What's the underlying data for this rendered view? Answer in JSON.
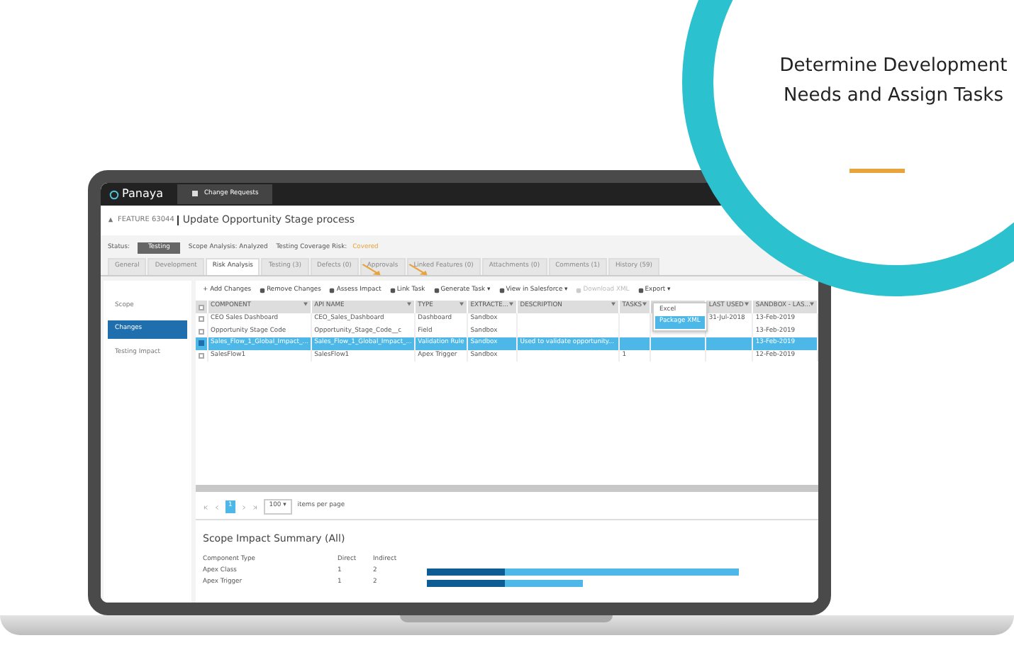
{
  "app": {
    "logo": "Panaya",
    "nav_tab": "Change Requests"
  },
  "feature": {
    "id": "FEATURE 63044",
    "title": "Update Opportunity Stage process"
  },
  "status": {
    "label": "Status:",
    "value": "Testing",
    "scope": "Scope Analysis: Analyzed",
    "risk_label": "Testing Coverage Risk:",
    "risk_value": "Covered"
  },
  "tabs": [
    {
      "label": "General",
      "selected": false
    },
    {
      "label": "Development",
      "selected": false
    },
    {
      "label": "Risk Analysis",
      "selected": true
    },
    {
      "label": "Testing (3)",
      "selected": false
    },
    {
      "label": "Defects (0)",
      "selected": false
    },
    {
      "label": "Approvals",
      "selected": false
    },
    {
      "label": "Linked Features (0)",
      "selected": false
    },
    {
      "label": "Attachments (0)",
      "selected": false
    },
    {
      "label": "Comments (1)",
      "selected": false
    },
    {
      "label": "History (59)",
      "selected": false
    }
  ],
  "side_tabs": [
    {
      "label": "Scope",
      "selected": false
    },
    {
      "label": "Changes",
      "selected": true
    },
    {
      "label": "Testing Impact",
      "selected": false
    }
  ],
  "toolbar": [
    {
      "label": "+ Add Changes",
      "disabled": false
    },
    {
      "label": "Remove Changes",
      "disabled": false
    },
    {
      "label": "Assess Impact",
      "disabled": false
    },
    {
      "label": "Link Task",
      "disabled": false
    },
    {
      "label": "Generate Task ▾",
      "disabled": false
    },
    {
      "label": "View in Salesforce ▾",
      "disabled": false
    },
    {
      "label": "Download XML",
      "disabled": true
    },
    {
      "label": "Export ▾",
      "disabled": false
    }
  ],
  "export_menu": [
    {
      "label": "Excel",
      "selected": false
    },
    {
      "label": "Package XML",
      "selected": true
    }
  ],
  "table": {
    "select_all": {
      "checked": false
    },
    "columns": [
      "COMPONENT",
      "API NAME",
      "TYPE",
      "EXTRACTE...",
      "DESCRIPTION",
      "TASKS",
      "LAST USED",
      "SANDBOX - LAS..."
    ],
    "rows": [
      {
        "checked": false,
        "selected": false,
        "cells": [
          "CEO Sales Dashboard",
          "CEO_Sales_Dashboard",
          "Dashboard",
          "Sandbox",
          "",
          "",
          "31-Jul-2018",
          "13-Feb-2019"
        ]
      },
      {
        "checked": false,
        "selected": false,
        "cells": [
          "Opportunity Stage Code",
          "Opportunity_Stage_Code__c",
          "Field",
          "Sandbox",
          "",
          "",
          "",
          "13-Feb-2019"
        ]
      },
      {
        "checked": true,
        "selected": true,
        "cells": [
          "Sales_Flow_1_Global_Impact_...",
          "Sales_Flow_1_Global_Impact_...",
          "Validation Rule",
          "Sandbox",
          "Used to validate opportunity...",
          "",
          "",
          "13-Feb-2019"
        ]
      },
      {
        "checked": false,
        "selected": false,
        "cells": [
          "SalesFlow1",
          "SalesFlow1",
          "Apex Trigger",
          "Sandbox",
          "",
          "1",
          "",
          "12-Feb-2019"
        ]
      }
    ]
  },
  "pager": {
    "pages": [
      {
        "label": "1",
        "selected": true
      }
    ],
    "page_size": "100 ▾",
    "page_size_label": "items per page"
  },
  "summary": {
    "title": "Scope Impact Summary (All)",
    "columns": [
      "Component Type",
      "Direct",
      "Indirect"
    ],
    "rows": [
      {
        "cells": [
          "Apex Class",
          "1",
          "2"
        ]
      },
      {
        "cells": [
          "Apex Trigger",
          "1",
          "2"
        ]
      }
    ]
  },
  "promo": {
    "heading": "Determine Development Needs and Assign Tasks"
  }
}
